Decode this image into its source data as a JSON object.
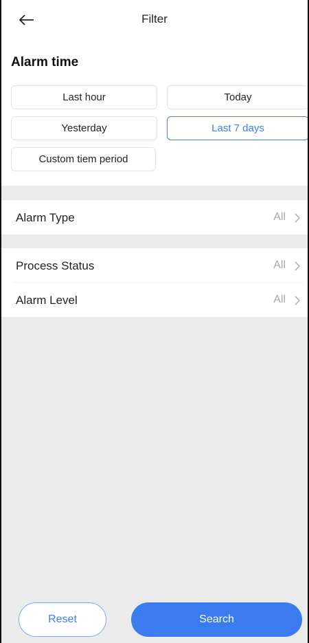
{
  "header": {
    "title": "Filter",
    "back_icon": "arrow-left-icon"
  },
  "alarm_time": {
    "title": "Alarm time",
    "options": [
      {
        "label": "Last hour",
        "selected": false
      },
      {
        "label": "Today",
        "selected": false
      },
      {
        "label": "Yesterday",
        "selected": false
      },
      {
        "label": "Last 7 days",
        "selected": true
      },
      {
        "label": "Custom tiem period",
        "selected": false
      }
    ]
  },
  "filters": {
    "alarm_type": {
      "label": "Alarm Type",
      "value": "All"
    },
    "process_status": {
      "label": "Process Status",
      "value": "All"
    },
    "alarm_level": {
      "label": "Alarm Level",
      "value": "All"
    }
  },
  "footer": {
    "reset_label": "Reset",
    "search_label": "Search"
  },
  "colors": {
    "accent": "#3a7bef",
    "page_background": "#ebebeb",
    "muted_text": "#a8a8a8"
  }
}
